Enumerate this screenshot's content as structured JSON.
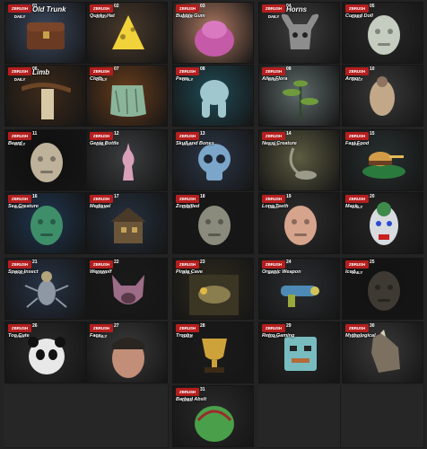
{
  "badge_text": "ZBRUSH DAILY",
  "tiles": [
    {
      "title": "Old Trunk",
      "num": "01",
      "bg": "#3b4960",
      "obj": "#6a3a22",
      "shape": "box",
      "big": true
    },
    {
      "title": "Quirky Hat",
      "num": "02",
      "bg": "#4a3a2c",
      "obj": "#f2d23a",
      "shape": "hat",
      "big": false
    },
    {
      "title": "Bubble Gum",
      "num": "03",
      "bg": "#b07a63",
      "obj": "#c55aa9",
      "shape": "blob",
      "big": false
    },
    {
      "title": "Horns",
      "num": "04",
      "bg": "#3e3e3e",
      "obj": "#8d8d8d",
      "shape": "mask",
      "big": true
    },
    {
      "title": "Cursed Doll",
      "num": "05",
      "bg": "#2a2a2a",
      "obj": "#c5ccc0",
      "shape": "head",
      "big": false
    },
    {
      "title": "Limb",
      "num": "06",
      "bg": "#3e2a1a",
      "obj": "#d8c9a6",
      "shape": "branch",
      "big": true
    },
    {
      "title": "Cloth",
      "num": "07",
      "bg": "#6b3e1c",
      "obj": "#8bb59a",
      "shape": "cloth",
      "big": false
    },
    {
      "title": "Paws",
      "num": "08",
      "bg": "#1f4b56",
      "obj": "#a0c7ce",
      "shape": "paws",
      "big": false
    },
    {
      "title": "Alien Flora",
      "num": "09",
      "bg": "#5e6b6a",
      "obj": "#6f9b3c",
      "shape": "plant",
      "big": false
    },
    {
      "title": "Armor",
      "num": "10",
      "bg": "#3a3a3a",
      "obj": "#c2a889",
      "shape": "armor",
      "big": false
    },
    {
      "title": "Beard",
      "num": "11",
      "bg": "#0f0f0f",
      "obj": "#bfb29b",
      "shape": "head",
      "big": false
    },
    {
      "title": "Genie Bottle",
      "num": "12",
      "bg": "#3c3e40",
      "obj": "#d9a0b9",
      "shape": "chess",
      "big": false
    },
    {
      "title": "Skull and Bones",
      "num": "13",
      "bg": "#2d3849",
      "obj": "#7ba6c9",
      "shape": "skull",
      "big": false
    },
    {
      "title": "Nessi Creature",
      "num": "14",
      "bg": "#5d5c42",
      "obj": "#9b9b89",
      "shape": "swan",
      "big": false
    },
    {
      "title": "Fast Food",
      "num": "15",
      "bg": "#283030",
      "obj": "#d29b48",
      "shape": "burger",
      "big": false
    },
    {
      "title": "Sea Creature",
      "num": "16",
      "bg": "#1f3651",
      "obj": "#3e8e6a",
      "shape": "head",
      "big": false
    },
    {
      "title": "Medieval",
      "num": "17",
      "bg": "#25313f",
      "obj": "#6b5538",
      "shape": "house",
      "big": false
    },
    {
      "title": "Zombified",
      "num": "18",
      "bg": "#181818",
      "obj": "#8a8b7c",
      "shape": "head",
      "big": false
    },
    {
      "title": "Long Teeth",
      "num": "19",
      "bg": "#2e2e2e",
      "obj": "#d6a48c",
      "shape": "head",
      "big": false
    },
    {
      "title": "Mask",
      "num": "20",
      "bg": "#262626",
      "obj": "#d8dbe0",
      "shape": "mask2",
      "big": false
    },
    {
      "title": "Space Insect",
      "num": "21",
      "bg": "#283448",
      "obj": "#8e98a4",
      "shape": "insect",
      "big": false
    },
    {
      "title": "Werewolf",
      "num": "22",
      "bg": "#1a1a1a",
      "obj": "#9d6c86",
      "shape": "wolf",
      "big": false
    },
    {
      "title": "Pirate Cave",
      "num": "23",
      "bg": "#2e2a1d",
      "obj": "#8a7d4e",
      "shape": "cave",
      "big": false
    },
    {
      "title": "Organic Weapon",
      "num": "24",
      "bg": "#2a2e32",
      "obj": "#4d8ab5",
      "shape": "gun",
      "big": false
    },
    {
      "title": "Iced",
      "num": "25",
      "bg": "#121212",
      "obj": "#3e3a33",
      "shape": "head",
      "big": false
    },
    {
      "title": "Too Cute",
      "num": "26",
      "bg": "#2b2b2b",
      "obj": "#e8e8e8",
      "shape": "panda",
      "big": false
    },
    {
      "title": "Face",
      "num": "27",
      "bg": "#3a3a3a",
      "obj": "#c28e78",
      "shape": "face",
      "big": false
    },
    {
      "title": "Trophy",
      "num": "28",
      "bg": "#1b1b1b",
      "obj": "#cda23a",
      "shape": "trophy",
      "big": false
    },
    {
      "title": "Retro Gaming",
      "num": "29",
      "bg": "#272727",
      "obj": "#78bcc0",
      "shape": "robot",
      "big": false
    },
    {
      "title": "Mythological",
      "num": "30",
      "bg": "#3a3a3a",
      "obj": "#7c7061",
      "shape": "horse",
      "big": false
    },
    {
      "title": "Barbed Abslt",
      "num": "31",
      "bg": "#2b2b2b",
      "obj": "#4aa04a",
      "shape": "monster",
      "big": false
    }
  ]
}
